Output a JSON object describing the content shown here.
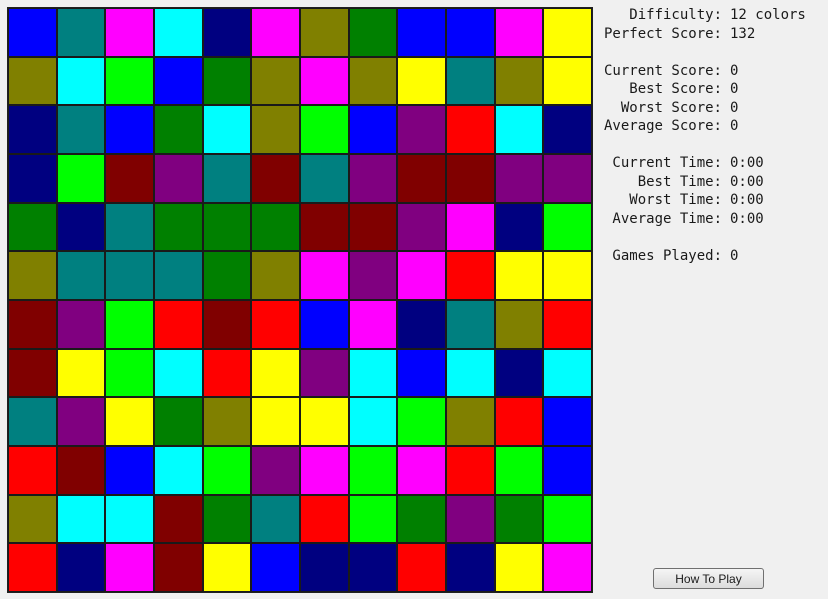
{
  "colors": {
    "B": "#0000ff",
    "T": "#008080",
    "M": "#ff00ff",
    "C": "#00ffff",
    "N": "#000080",
    "O": "#808000",
    "G": "#008000",
    "Y": "#ffff00",
    "L": "#00ff00",
    "P": "#800080",
    "R": "#ff0000",
    "D": "#800000"
  },
  "board": [
    [
      "B",
      "T",
      "M",
      "C",
      "N",
      "M",
      "O",
      "G",
      "B",
      "B",
      "M",
      "Y"
    ],
    [
      "O",
      "C",
      "L",
      "B",
      "G",
      "O",
      "M",
      "O",
      "Y",
      "T",
      "O",
      "Y"
    ],
    [
      "N",
      "T",
      "B",
      "G",
      "C",
      "O",
      "L",
      "B",
      "P",
      "R",
      "C",
      "N"
    ],
    [
      "N",
      "L",
      "D",
      "P",
      "T",
      "D",
      "T",
      "P",
      "D",
      "D",
      "P",
      "P"
    ],
    [
      "G",
      "N",
      "T",
      "G",
      "G",
      "G",
      "D",
      "D",
      "P",
      "M",
      "N",
      "L"
    ],
    [
      "O",
      "T",
      "T",
      "T",
      "G",
      "O",
      "M",
      "P",
      "M",
      "R",
      "Y",
      "Y"
    ],
    [
      "D",
      "P",
      "L",
      "R",
      "D",
      "R",
      "B",
      "M",
      "N",
      "T",
      "O",
      "R"
    ],
    [
      "D",
      "Y",
      "L",
      "C",
      "R",
      "Y",
      "P",
      "C",
      "B",
      "C",
      "N",
      "C"
    ],
    [
      "T",
      "P",
      "Y",
      "G",
      "O",
      "Y",
      "Y",
      "C",
      "L",
      "O",
      "R",
      "B"
    ],
    [
      "R",
      "D",
      "B",
      "C",
      "L",
      "P",
      "M",
      "L",
      "M",
      "R",
      "L",
      "B"
    ],
    [
      "O",
      "C",
      "C",
      "D",
      "G",
      "T",
      "R",
      "L",
      "G",
      "P",
      "G",
      "L"
    ],
    [
      "R",
      "N",
      "M",
      "D",
      "Y",
      "B",
      "N",
      "N",
      "R",
      "N",
      "Y",
      "M"
    ]
  ],
  "stats": {
    "difficulty_label": "Difficulty:",
    "difficulty_value": "12 colors",
    "perfect_label": "Perfect Score:",
    "perfect_value": "132",
    "current_score_label": "Current Score:",
    "current_score_value": "0",
    "best_score_label": "Best Score:",
    "best_score_value": "0",
    "worst_score_label": "Worst Score:",
    "worst_score_value": "0",
    "average_score_label": "Average Score:",
    "average_score_value": "0",
    "current_time_label": "Current Time:",
    "current_time_value": "0:00",
    "best_time_label": "Best Time:",
    "best_time_value": "0:00",
    "worst_time_label": "Worst Time:",
    "worst_time_value": "0:00",
    "average_time_label": "Average Time:",
    "average_time_value": "0:00",
    "games_played_label": "Games Played:",
    "games_played_value": "0"
  },
  "buttons": {
    "how_to_play": "How To Play"
  }
}
